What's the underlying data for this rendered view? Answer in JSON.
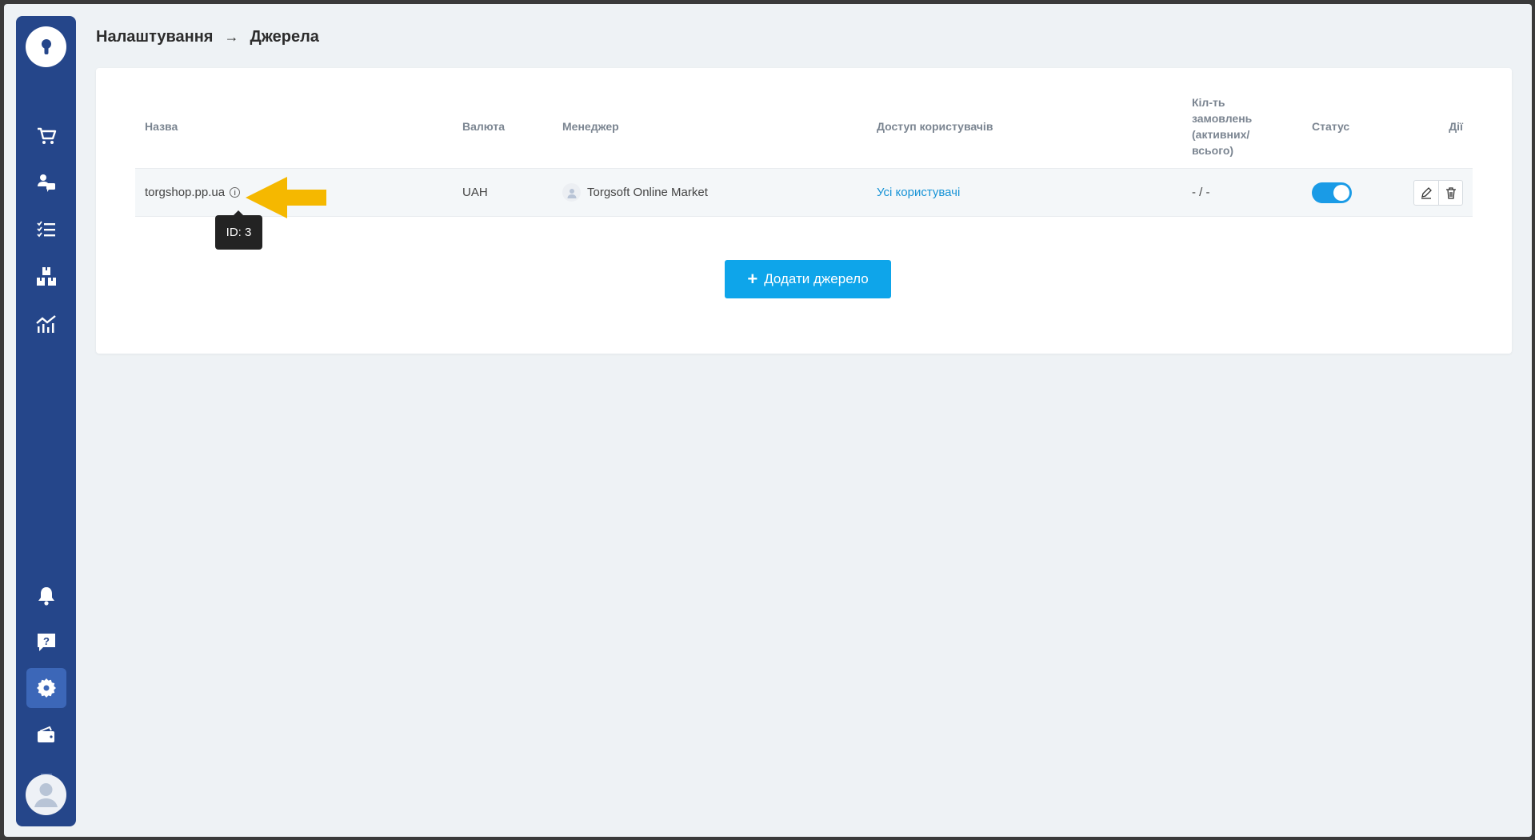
{
  "breadcrumb": {
    "parent": "Налаштування",
    "separator": "→",
    "current": "Джерела"
  },
  "sidebar": {
    "items": [
      {
        "name": "cart-icon"
      },
      {
        "name": "customers-chat-icon"
      },
      {
        "name": "tasks-list-icon"
      },
      {
        "name": "boxes-icon"
      },
      {
        "name": "analytics-icon"
      },
      {
        "name": "bell-icon"
      },
      {
        "name": "help-icon"
      },
      {
        "name": "gear-icon",
        "active": true
      },
      {
        "name": "wallet-icon"
      }
    ]
  },
  "table": {
    "headers": {
      "name": "Назва",
      "currency": "Валюта",
      "manager": "Менеджер",
      "access": "Доступ користувачів",
      "orders": "Кіл-ть замовлень (активних/ всього)",
      "status": "Статус",
      "actions": "Дії"
    },
    "rows": [
      {
        "name": "torgshop.pp.ua",
        "currency": "UAH",
        "manager": "Torgsoft Online Market",
        "access": "Усі користувачі",
        "orders": "- / -",
        "status": true
      }
    ]
  },
  "tooltip": {
    "text": "ID: 3"
  },
  "add_button": {
    "label": "Додати джерело"
  },
  "colors": {
    "sidebar": "#25468a",
    "accent": "#0ea5ea",
    "link": "#1793d6",
    "arrow": "#f5b800"
  }
}
